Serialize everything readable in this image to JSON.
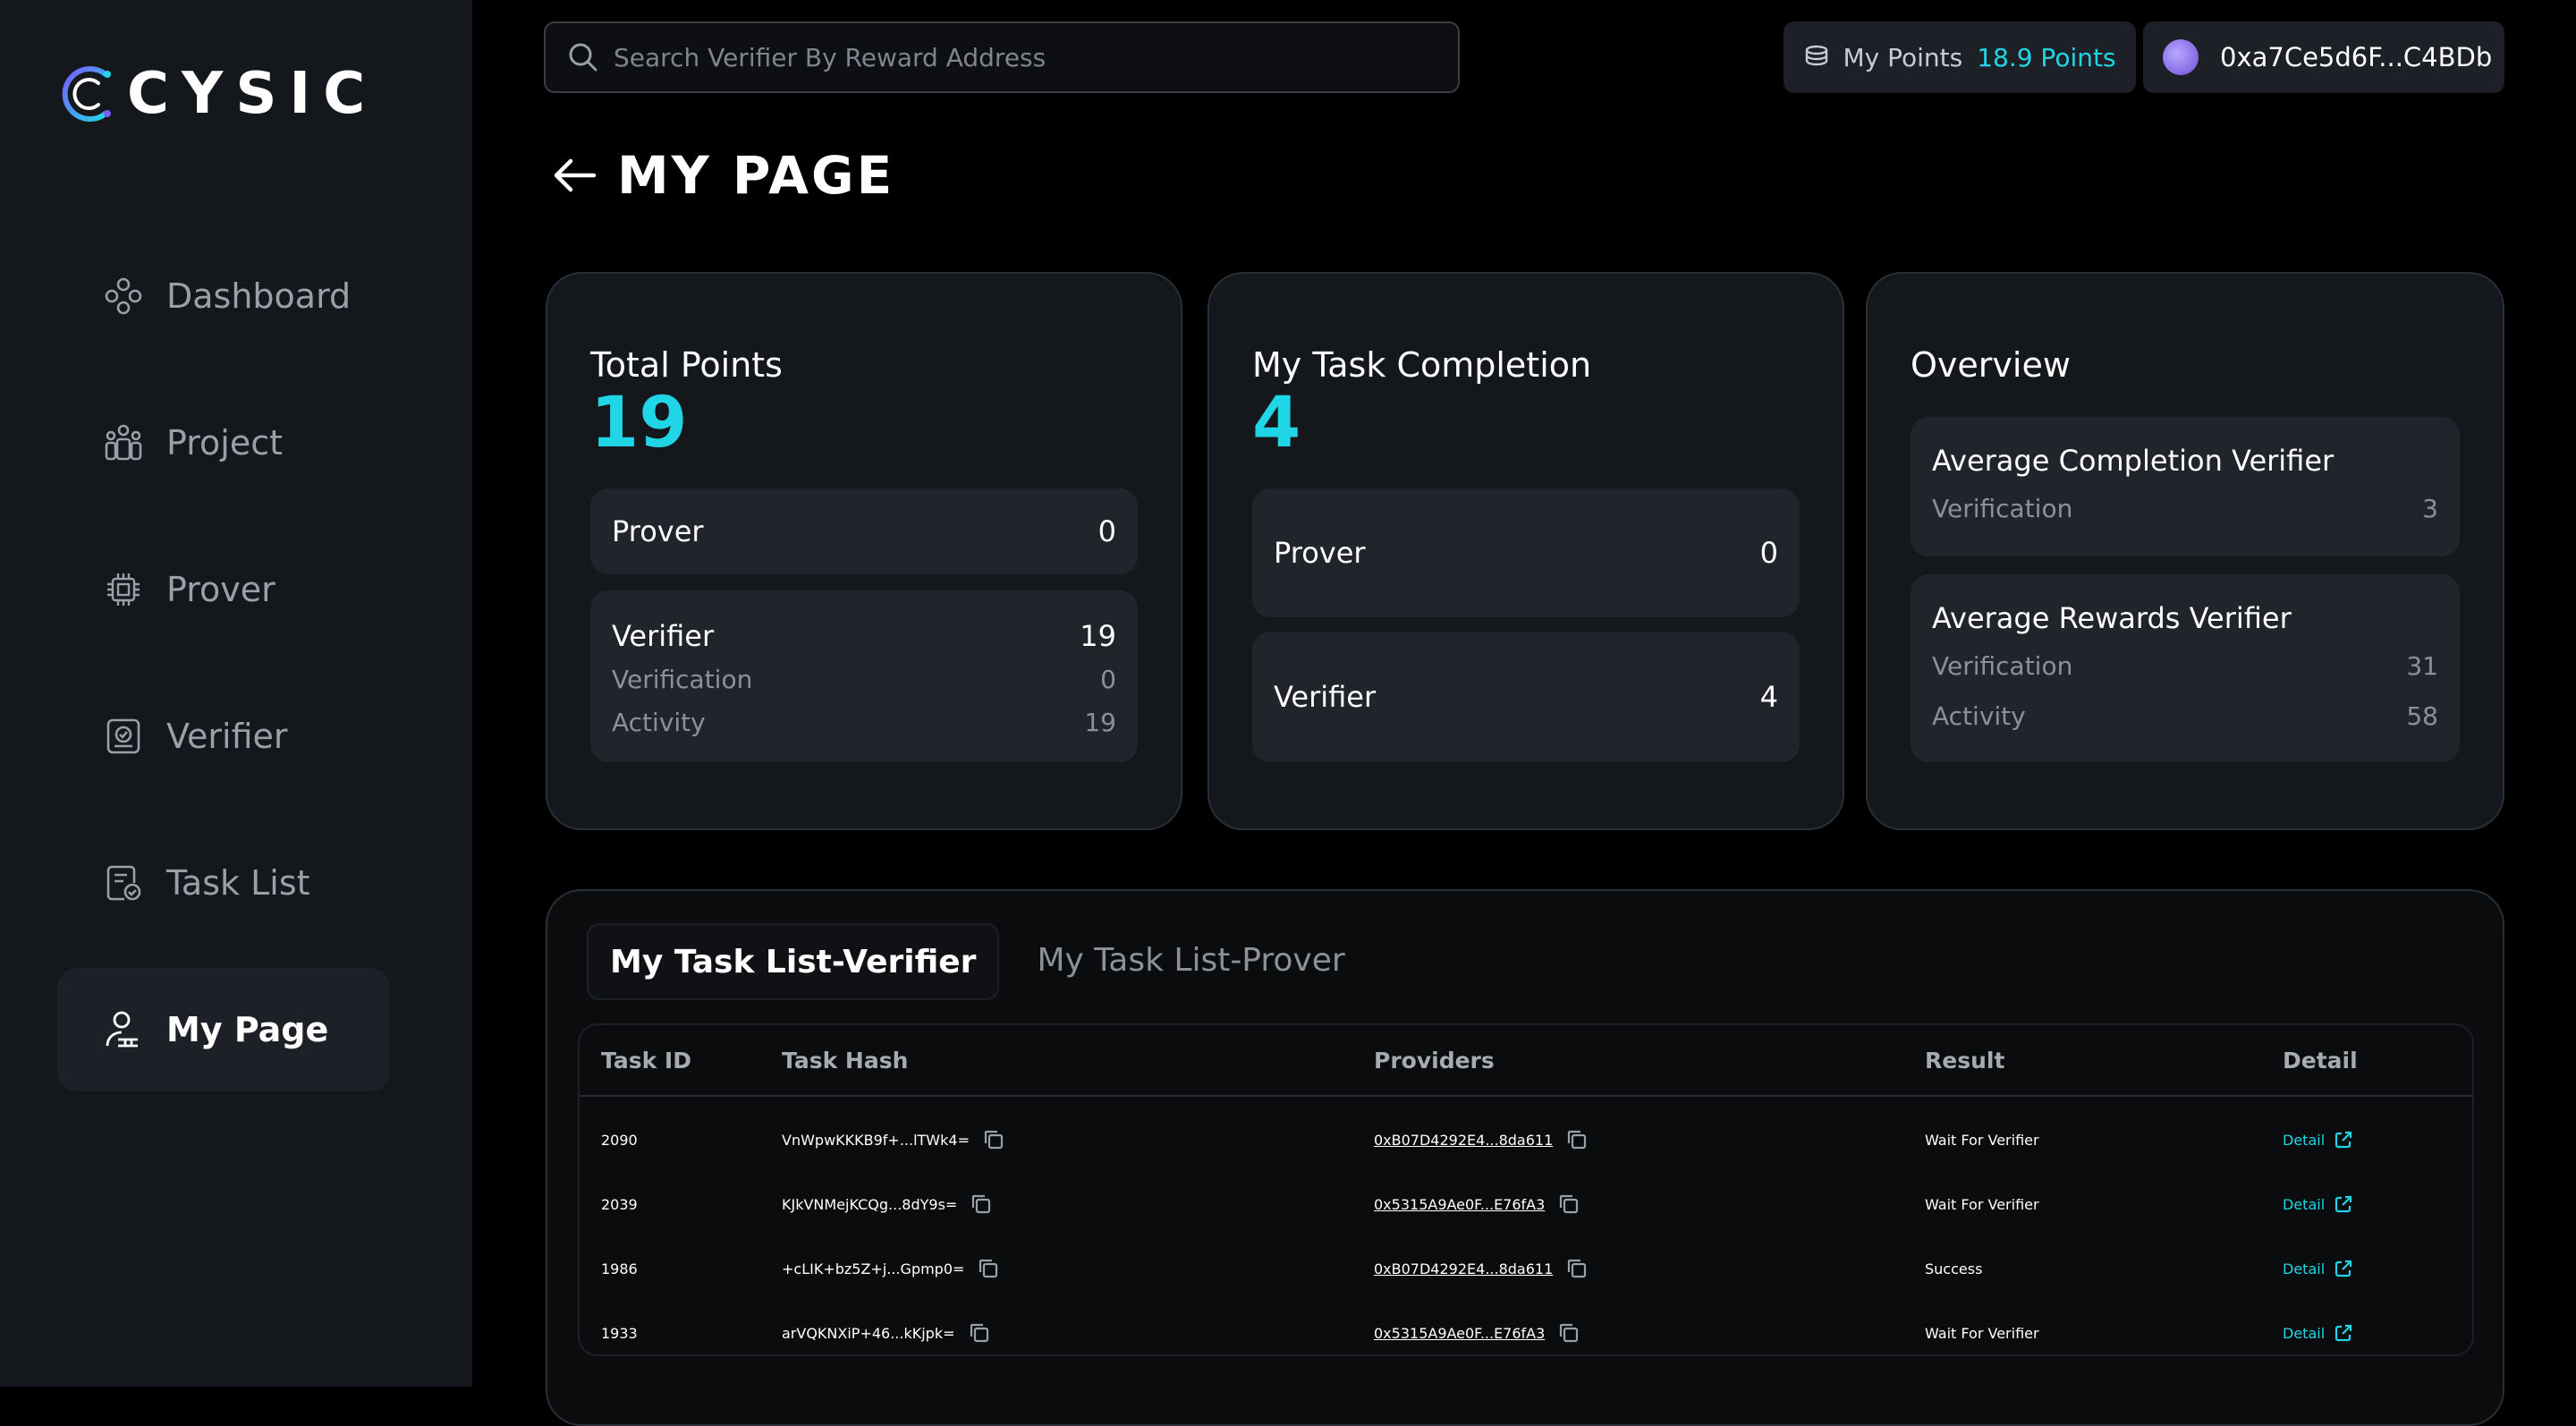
{
  "brand": {
    "name": "CYSIC"
  },
  "nav": {
    "items": [
      {
        "label": "Dashboard",
        "icon": "dashboard-icon",
        "active": false
      },
      {
        "label": "Project",
        "icon": "project-icon",
        "active": false
      },
      {
        "label": "Prover",
        "icon": "prover-chip-icon",
        "active": false
      },
      {
        "label": "Verifier",
        "icon": "verifier-icon",
        "active": false
      },
      {
        "label": "Task List",
        "icon": "task-list-icon",
        "active": false
      },
      {
        "label": "My Page",
        "icon": "user-icon",
        "active": true
      }
    ]
  },
  "header": {
    "search_placeholder": "Search Verifier By Reward Address",
    "points_label": "My Points",
    "points_value": "18.9 Points",
    "wallet_address": "0xa7Ce5d6F...C4BDb"
  },
  "page": {
    "title": "MY PAGE"
  },
  "total_points": {
    "title": "Total Points",
    "value": "19",
    "prover_label": "Prover",
    "prover_value": "0",
    "verifier_label": "Verifier",
    "verifier_value": "19",
    "verification_label": "Verification",
    "verification_value": "0",
    "activity_label": "Activity",
    "activity_value": "19"
  },
  "task_completion": {
    "title": "My Task Completion",
    "value": "4",
    "prover_label": "Prover",
    "prover_value": "0",
    "verifier_label": "Verifier",
    "verifier_value": "4"
  },
  "overview": {
    "title": "Overview",
    "completion_title": "Average Completion Verifier",
    "completion_verification_label": "Verification",
    "completion_verification_value": "3",
    "rewards_title": "Average Rewards Verifier",
    "rewards_verification_label": "Verification",
    "rewards_verification_value": "31",
    "rewards_activity_label": "Activity",
    "rewards_activity_value": "58"
  },
  "task_list": {
    "tabs": [
      "My Task List-Verifier",
      "My Task List-Prover"
    ],
    "columns": [
      "Task ID",
      "Task Hash",
      "Providers",
      "Result",
      "Detail"
    ],
    "rows": [
      {
        "id": "2090",
        "hash": "VnWpwKKKB9f+...lTWk4=",
        "provider": "0xB07D4292E4...8da611",
        "result": "Wait For Verifier",
        "detail": "Detail"
      },
      {
        "id": "2039",
        "hash": "KJkVNMejKCQg...8dY9s=",
        "provider": "0x5315A9Ae0F...E76fA3",
        "result": "Wait For Verifier",
        "detail": "Detail"
      },
      {
        "id": "1986",
        "hash": "+cLIK+bz5Z+j...Gpmp0=",
        "provider": "0xB07D4292E4...8da611",
        "result": "Success",
        "detail": "Detail"
      },
      {
        "id": "1933",
        "hash": "arVQKNXiP+46...kKjpk=",
        "provider": "0x5315A9Ae0F...E76fA3",
        "result": "Wait For Verifier",
        "detail": "Detail"
      }
    ]
  },
  "colors": {
    "accent": "#20d6e6",
    "sidebar": "#14171c",
    "card": "#14171b"
  }
}
